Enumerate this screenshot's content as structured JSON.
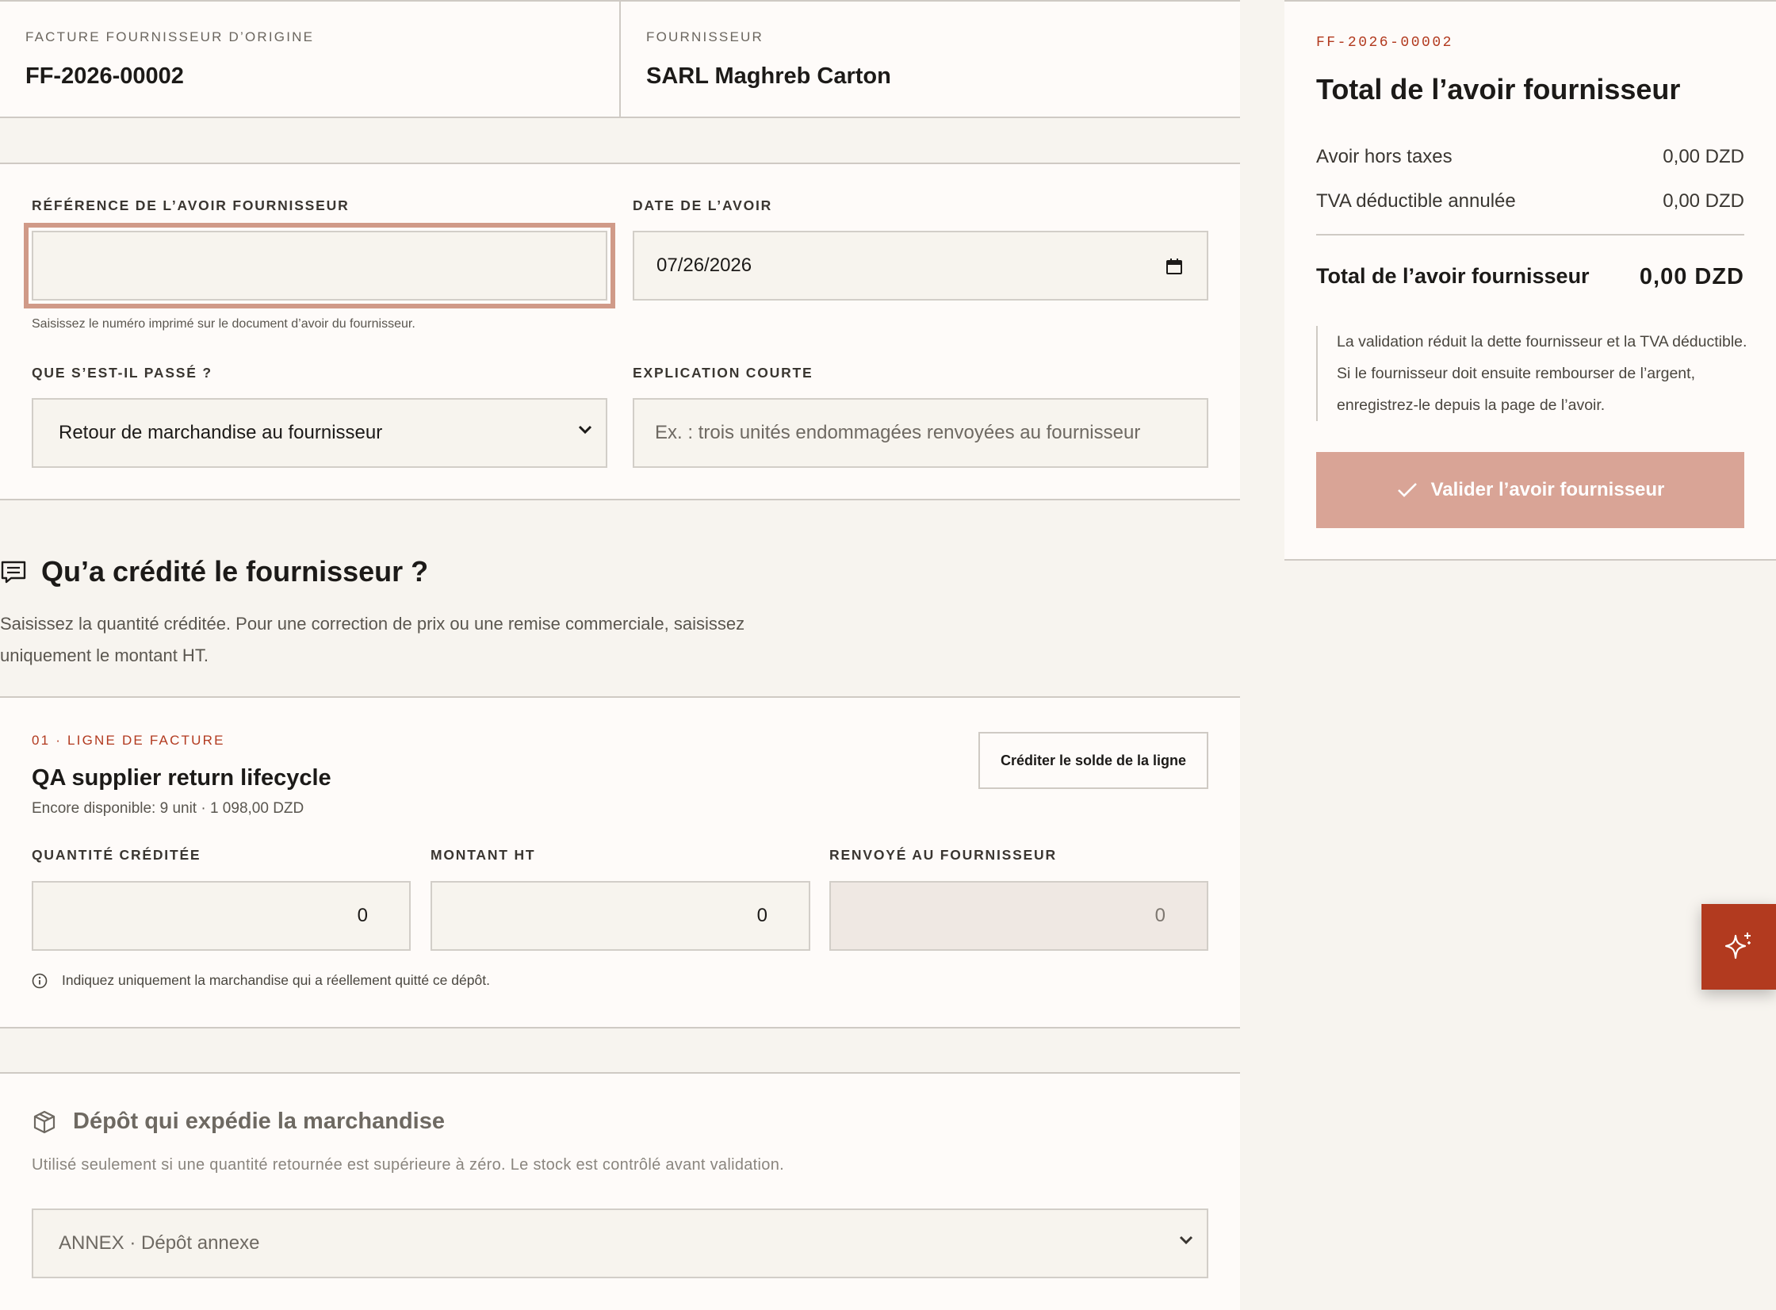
{
  "origin": {
    "invoice_label": "FACTURE FOURNISSEUR D’ORIGINE",
    "invoice_value": "FF-2026-00002",
    "supplier_label": "FOURNISSEUR",
    "supplier_value": "SARL Maghreb Carton"
  },
  "form": {
    "reference_label": "RÉFÉRENCE DE L’AVOIR FOURNISSEUR",
    "reference_value": "",
    "reference_hint": "Saisissez le numéro imprimé sur le document d’avoir du fournisseur.",
    "date_label": "DATE DE L’AVOIR",
    "date_value": "07/26/2026",
    "reason_label": "QUE S’EST-IL PASSÉ ?",
    "reason_value": "Retour de marchandise au fournisseur",
    "explanation_label": "EXPLICATION COURTE",
    "explanation_placeholder": "Ex. : trois unités endommagées renvoyées au fournisseur"
  },
  "credited_section": {
    "title": "Qu’a crédité le fournisseur ?",
    "description": "Saisissez la quantité créditée. Pour une correction de prix ou une remise commerciale, saisissez uniquement le montant HT."
  },
  "line": {
    "eyebrow": "01 · LIGNE DE FACTURE",
    "title": "QA supplier return lifecycle",
    "available": "Encore disponible: 9 unit · 1 098,00 DZD",
    "credit_balance_button": "Créditer le solde de la ligne",
    "qty_label": "QUANTITÉ CRÉDITÉE",
    "qty_value": "0",
    "amount_label": "MONTANT HT",
    "amount_value": "0",
    "returned_label": "RENVOYÉ AU FOURNISSEUR",
    "returned_value": "0",
    "info": "Indiquez uniquement la marchandise qui a réellement quitté ce dépôt."
  },
  "depot": {
    "title": "Dépôt qui expédie la marchandise",
    "description": "Utilisé seulement si une quantité retournée est supérieure à zéro. Le stock est contrôlé avant validation.",
    "selected": "ANNEX · Dépôt annexe"
  },
  "summary": {
    "ref": "FF-2026-00002",
    "title": "Total de l’avoir fournisseur",
    "ht_label": "Avoir hors taxes",
    "ht_value": "0,00 DZD",
    "tva_label": "TVA déductible annulée",
    "tva_value": "0,00 DZD",
    "total_label": "Total de l’avoir fournisseur",
    "total_value": "0,00 DZD",
    "note": "La validation réduit la dette fournisseur et la TVA déductible. Si le fournisseur doit ensuite rembourser de l’argent, enregistrez-le depuis la page de l’avoir.",
    "validate_button": "Valider l’avoir fournisseur"
  },
  "colors": {
    "accent": "#b23a1f",
    "button_disabled": "#d9a496",
    "card_bg": "#fefbf9",
    "page_bg": "#f7f4ef"
  },
  "icons": [
    "receipt-icon",
    "box-icon",
    "info-icon",
    "check-icon",
    "sparkle-icon",
    "chevron-down-icon",
    "calendar-icon"
  ]
}
